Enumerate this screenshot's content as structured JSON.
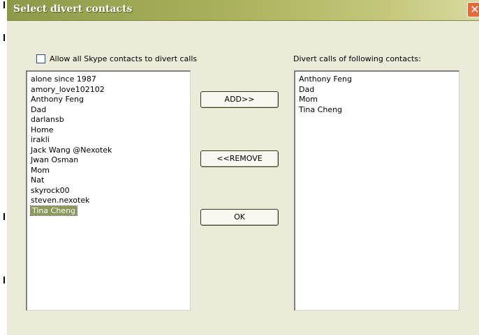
{
  "window": {
    "title": "Select divert contacts",
    "close_glyph": "✕"
  },
  "allow_all": {
    "label": "Allow all Skype contacts to divert calls",
    "checked": false
  },
  "left_list": {
    "items": [
      "alone since 1987",
      "amory_love102102",
      "Anthony Feng",
      "Dad",
      "darlansb",
      "Home",
      "irakli",
      "Jack Wang @Nexotek",
      "Jwan Osman",
      "Mom",
      "Nat",
      "skyrock00",
      "steven.nexotek",
      "Tina Cheng"
    ],
    "selected": "Tina Cheng"
  },
  "right_list": {
    "heading": "Divert calls of following contacts:",
    "items": [
      "Anthony Feng",
      "Dad",
      "Mom",
      "Tina Cheng"
    ]
  },
  "buttons": {
    "add": "ADD>>",
    "remove": "<<REMOVE",
    "ok": "OK"
  }
}
